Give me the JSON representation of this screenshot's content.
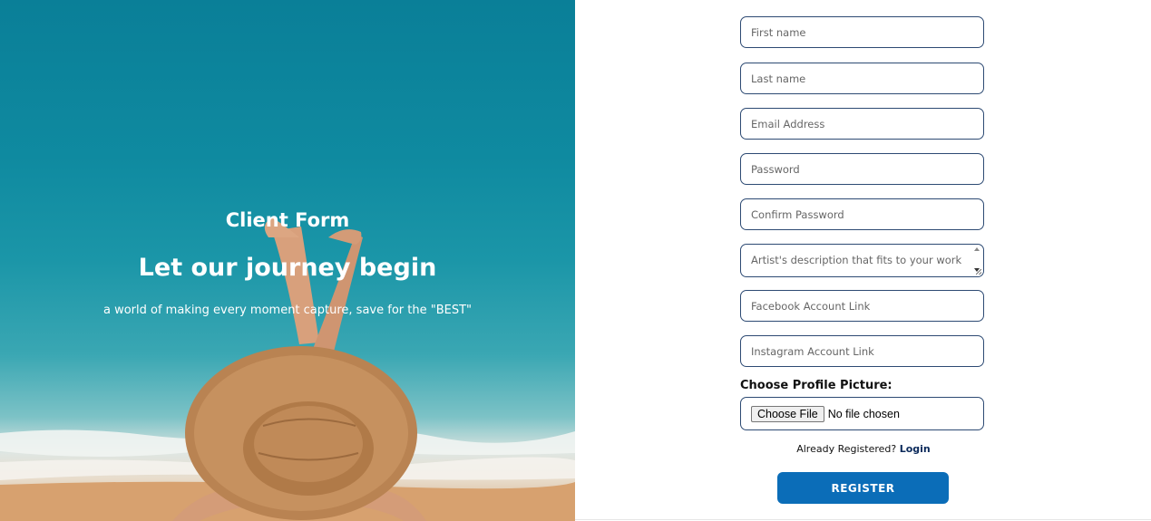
{
  "hero": {
    "title": "Client Form",
    "headline": "Let our journey begin",
    "tagline": "a world of making every moment capture, save for the \"BEST\""
  },
  "form": {
    "fields": {
      "first_name": {
        "placeholder": "First name"
      },
      "last_name": {
        "placeholder": "Last name"
      },
      "email": {
        "placeholder": "Email Address"
      },
      "password": {
        "placeholder": "Password"
      },
      "confirm_password": {
        "placeholder": "Confirm Password"
      },
      "description": {
        "placeholder": "Artist's description that fits to your work"
      },
      "facebook": {
        "placeholder": "Facebook Account Link"
      },
      "instagram": {
        "placeholder": "Instagram Account Link"
      }
    },
    "profile_picture": {
      "label": "Choose Profile Picture:",
      "button_label": "Choose File",
      "status": "No file chosen"
    },
    "login_prompt": "Already Registered?",
    "login_link": "Login",
    "register_label": "REGISTER"
  },
  "colors": {
    "accent": "#0b6db8",
    "field_border": "#2d4a73",
    "hero_sea": "#0f8aa0"
  }
}
